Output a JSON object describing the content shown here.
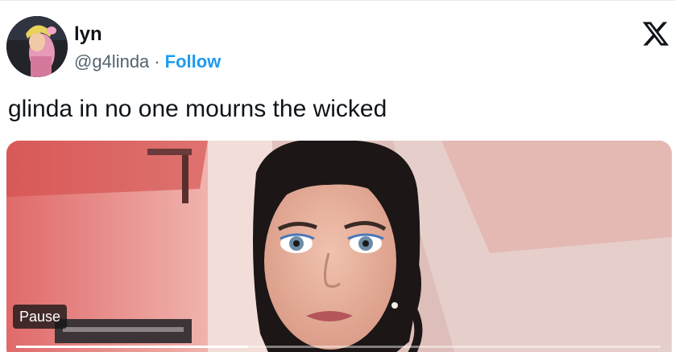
{
  "tweet": {
    "author": {
      "display_name": "lyn",
      "handle": "@g4linda",
      "separator": "·",
      "follow_label": "Follow",
      "avatar_icon": "avatar-photo"
    },
    "text": "glinda in no one mourns the wicked",
    "logo_icon": "x-logo-icon"
  },
  "video": {
    "pause_label": "Pause",
    "progress_fraction": 0.36
  },
  "colors": {
    "link": "#1d9bf0",
    "secondary_text": "#536471",
    "primary_text": "#0f1419"
  }
}
